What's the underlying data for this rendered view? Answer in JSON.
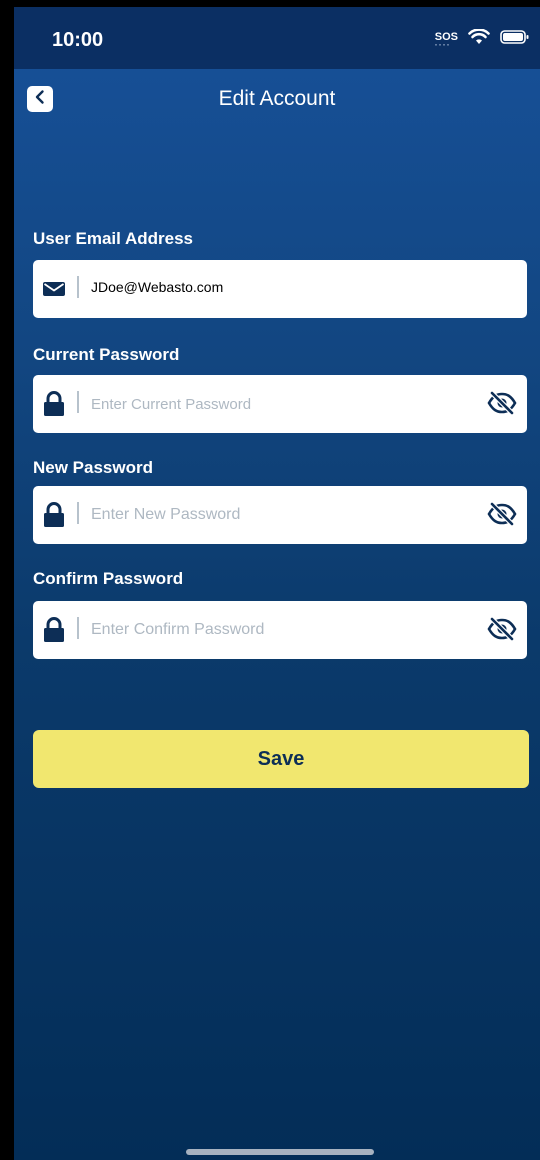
{
  "status_bar": {
    "time": "10:00",
    "sos": "SOS"
  },
  "nav": {
    "title": "Edit Account"
  },
  "form": {
    "email": {
      "label": "User Email Address",
      "value": "JDoe@Webasto.com"
    },
    "current_password": {
      "label": "Current Password",
      "placeholder": "Enter Current Password"
    },
    "new_password": {
      "label": "New Password",
      "placeholder": "Enter New Password"
    },
    "confirm_password": {
      "label": "Confirm Password",
      "placeholder": "Enter Confirm Password"
    }
  },
  "actions": {
    "save_label": "Save"
  },
  "colors": {
    "background_top": "#17519a",
    "background_bottom": "#032d57",
    "status_bar": "#0b2f63",
    "save_button": "#f1e76f",
    "save_text": "#0d2e56",
    "icon_dark": "#0d2e56"
  }
}
